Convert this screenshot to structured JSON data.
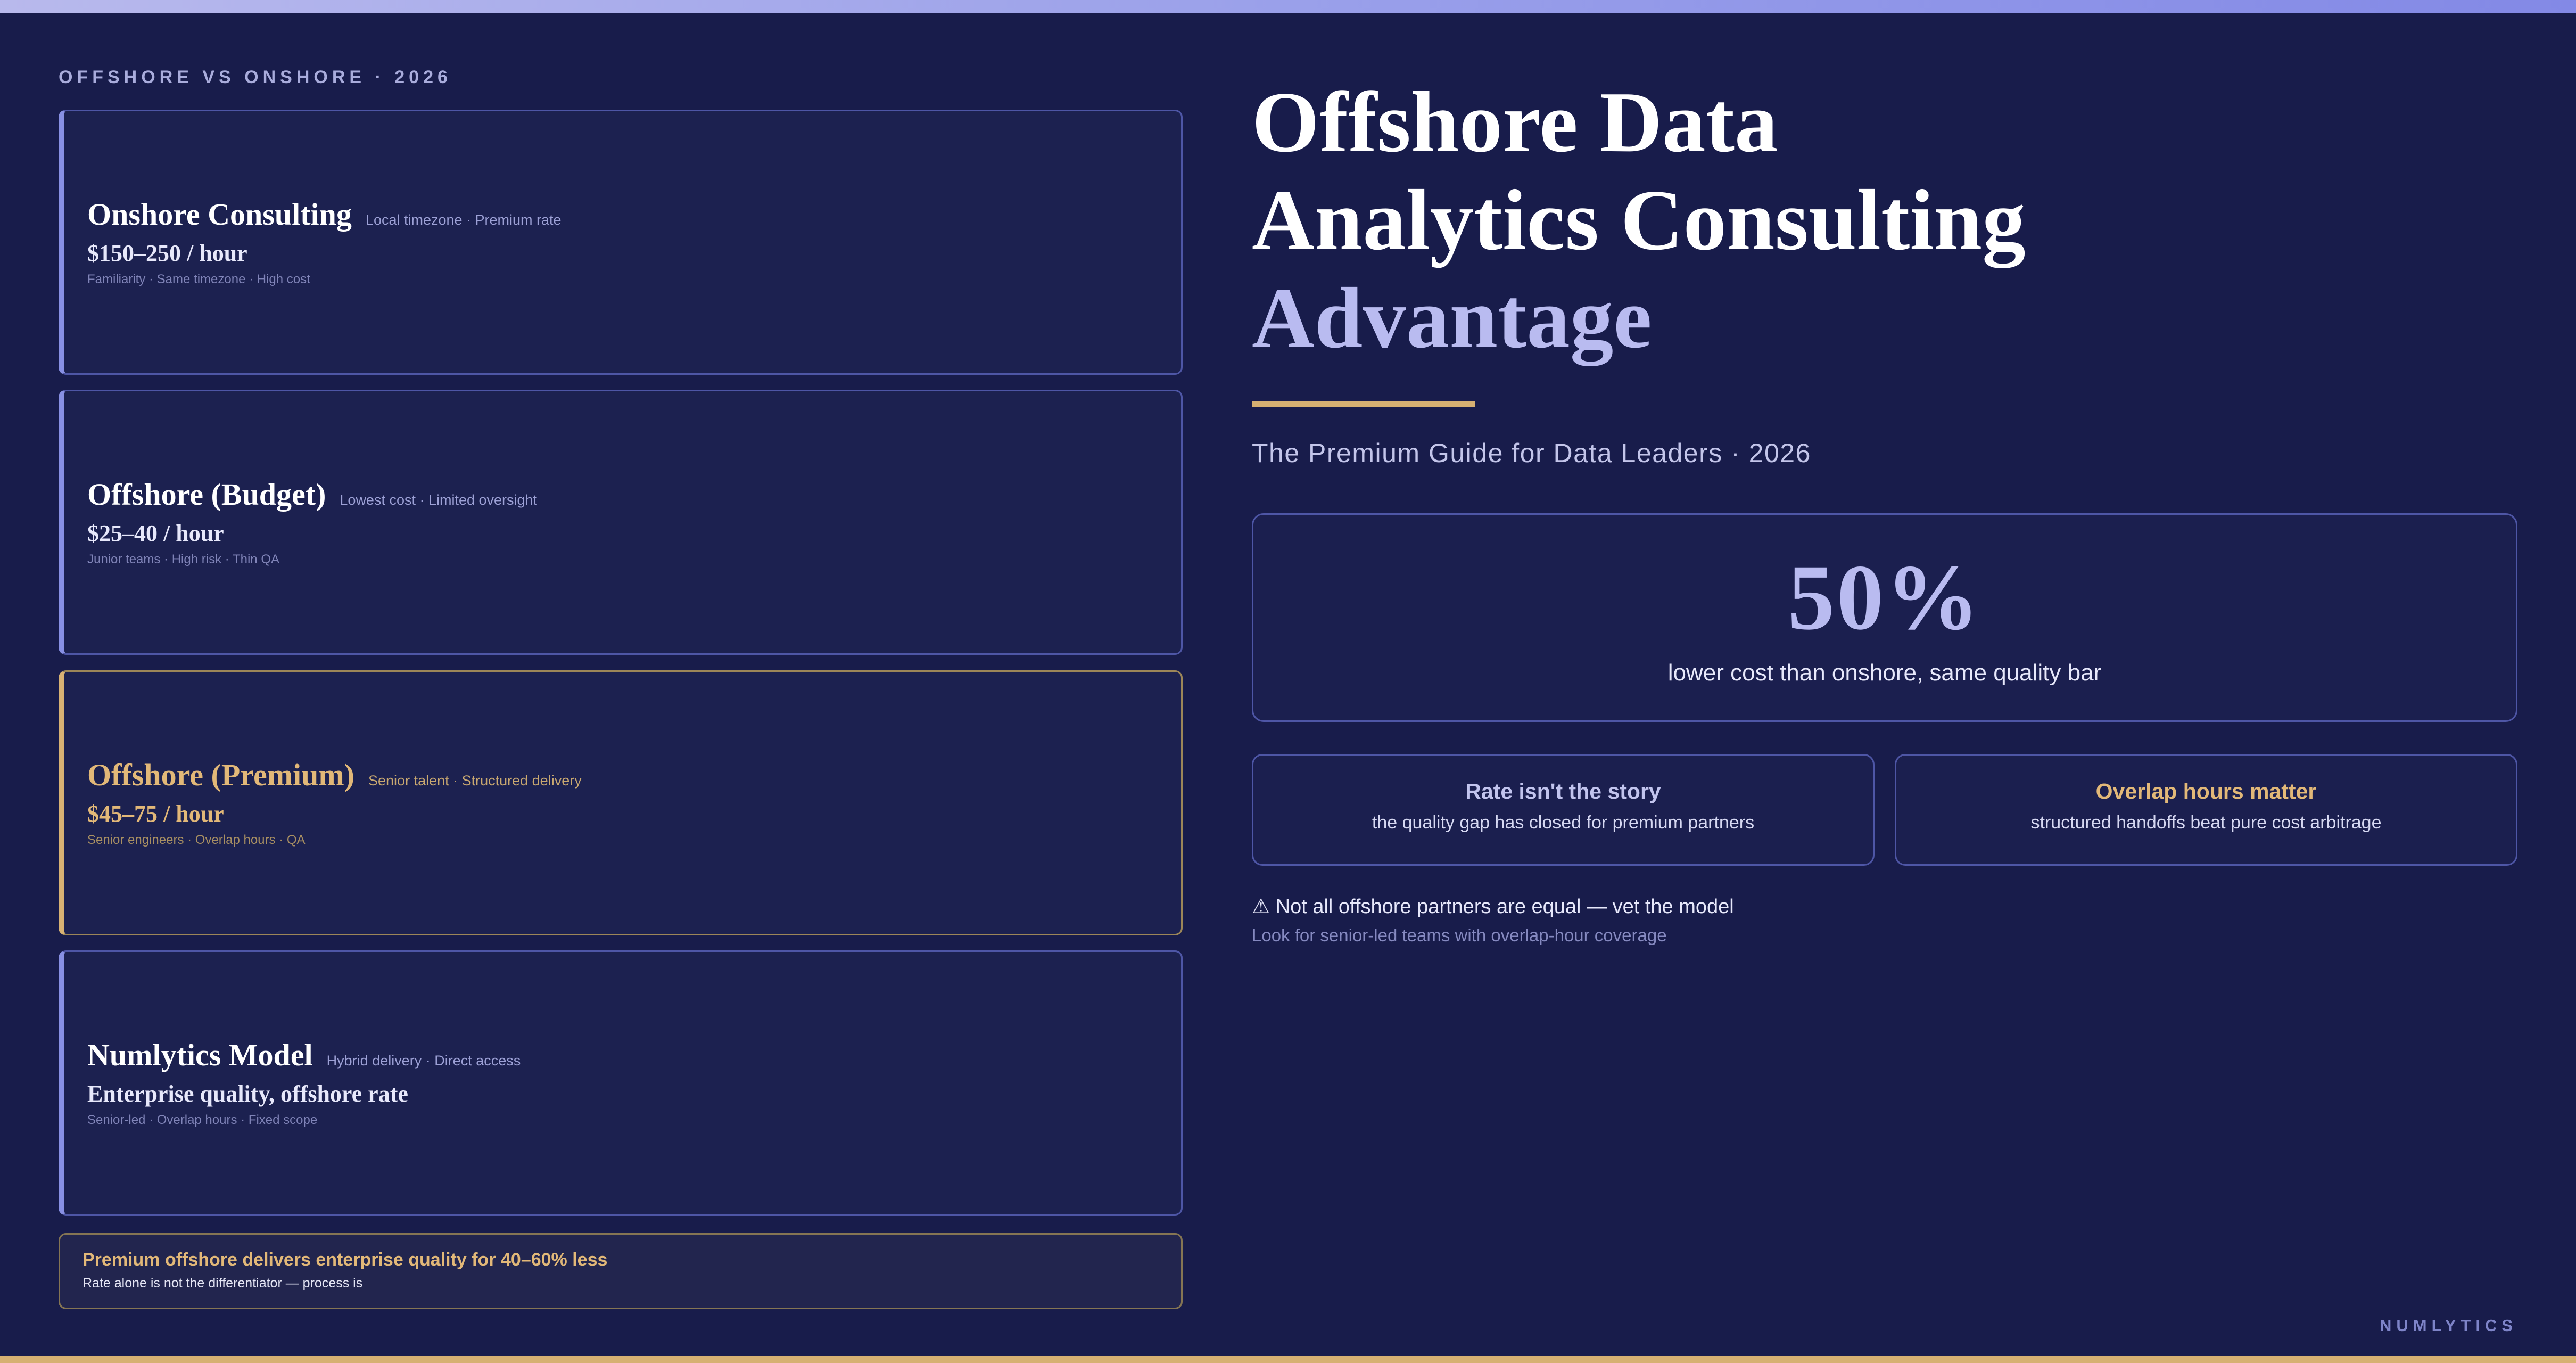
{
  "eyebrow": "OFFSHORE VS ONSHORE · 2026",
  "cards": [
    {
      "title": "Onshore Consulting",
      "tag": "Local timezone · Premium rate",
      "rate": "$150–250 / hour",
      "meta": "Familiarity · Same timezone · High cost"
    },
    {
      "title": "Offshore (Budget)",
      "tag": "Lowest cost · Limited oversight",
      "rate": "$25–40 / hour",
      "meta": "Junior teams · High risk · Thin QA"
    },
    {
      "title": "Offshore (Premium)",
      "tag": "Senior talent · Structured delivery",
      "rate": "$45–75 / hour",
      "meta": "Senior engineers · Overlap hours · QA"
    },
    {
      "title": "Numlytics Model",
      "tag": "Hybrid delivery · Direct access",
      "rate": "Enterprise quality, offshore rate",
      "meta": "Senior-led · Overlap hours · Fixed scope"
    }
  ],
  "callout": {
    "title": "Premium offshore delivers enterprise quality for 40–60% less",
    "subtitle": "Rate alone is not the differentiator — process is"
  },
  "headline": {
    "line1": "Offshore Data",
    "line2": "Analytics Consulting",
    "line3": "Advantage"
  },
  "subtitle": "The Premium Guide for Data Leaders · 2026",
  "stat": {
    "value": "50%",
    "caption": "lower cost than onshore, same quality bar"
  },
  "insights": [
    {
      "title": "Rate isn't the story",
      "text": "the quality gap has closed for premium partners"
    },
    {
      "title": "Overlap hours matter",
      "text": "structured handoffs beat pure cost arbitrage"
    }
  ],
  "warning": {
    "text": "⚠ Not all offshore partners are equal — vet the model",
    "subtext": "Look for senior-led teams with overlap-hour coverage"
  },
  "brand": "NUMLYTICS",
  "colors": {
    "background": "#181c4b",
    "accent_lavender": "#b9bbf0",
    "accent_gold": "#d6b072",
    "card_border": "#4e56a6"
  }
}
